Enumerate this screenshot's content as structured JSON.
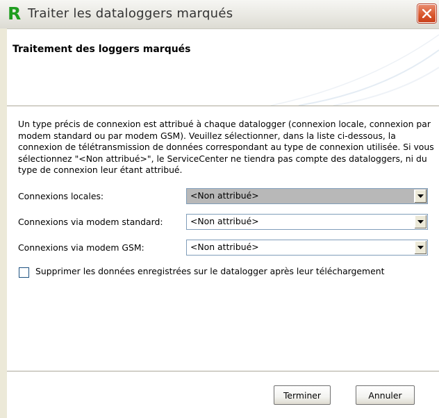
{
  "window": {
    "title": "Traiter les dataloggers marqués",
    "app_icon_letter": "R"
  },
  "header": {
    "title": "Traitement des loggers marqués"
  },
  "description": "Un type précis de connexion est attribué à chaque datalogger (connexion locale, connexion par modem standard ou par modem GSM). Veuillez sélectionner, dans la liste ci-dessous, la connexion de télétransmission de données correspondant au type de connexion utilisée. Si vous sélectionnez \"<Non attribué>\", le ServiceCenter ne tiendra pas compte des dataloggers, ni du type de connexion leur étant attribué.",
  "fields": [
    {
      "label": "Connexions locales:",
      "value": "<Non attribué>"
    },
    {
      "label": "Connexions via modem standard:",
      "value": "<Non attribué>"
    },
    {
      "label": "Connexions via modem GSM:",
      "value": "<Non attribué>"
    }
  ],
  "checkbox": {
    "label": "Supprimer les données enregistrées sur le datalogger après leur téléchargement",
    "checked": false
  },
  "buttons": {
    "finish": "Terminer",
    "cancel": "Annuler"
  },
  "colors": {
    "app_icon": "#1f9d1f",
    "close_button": "#d8562c",
    "selected_combo": "#b8b8b8"
  }
}
